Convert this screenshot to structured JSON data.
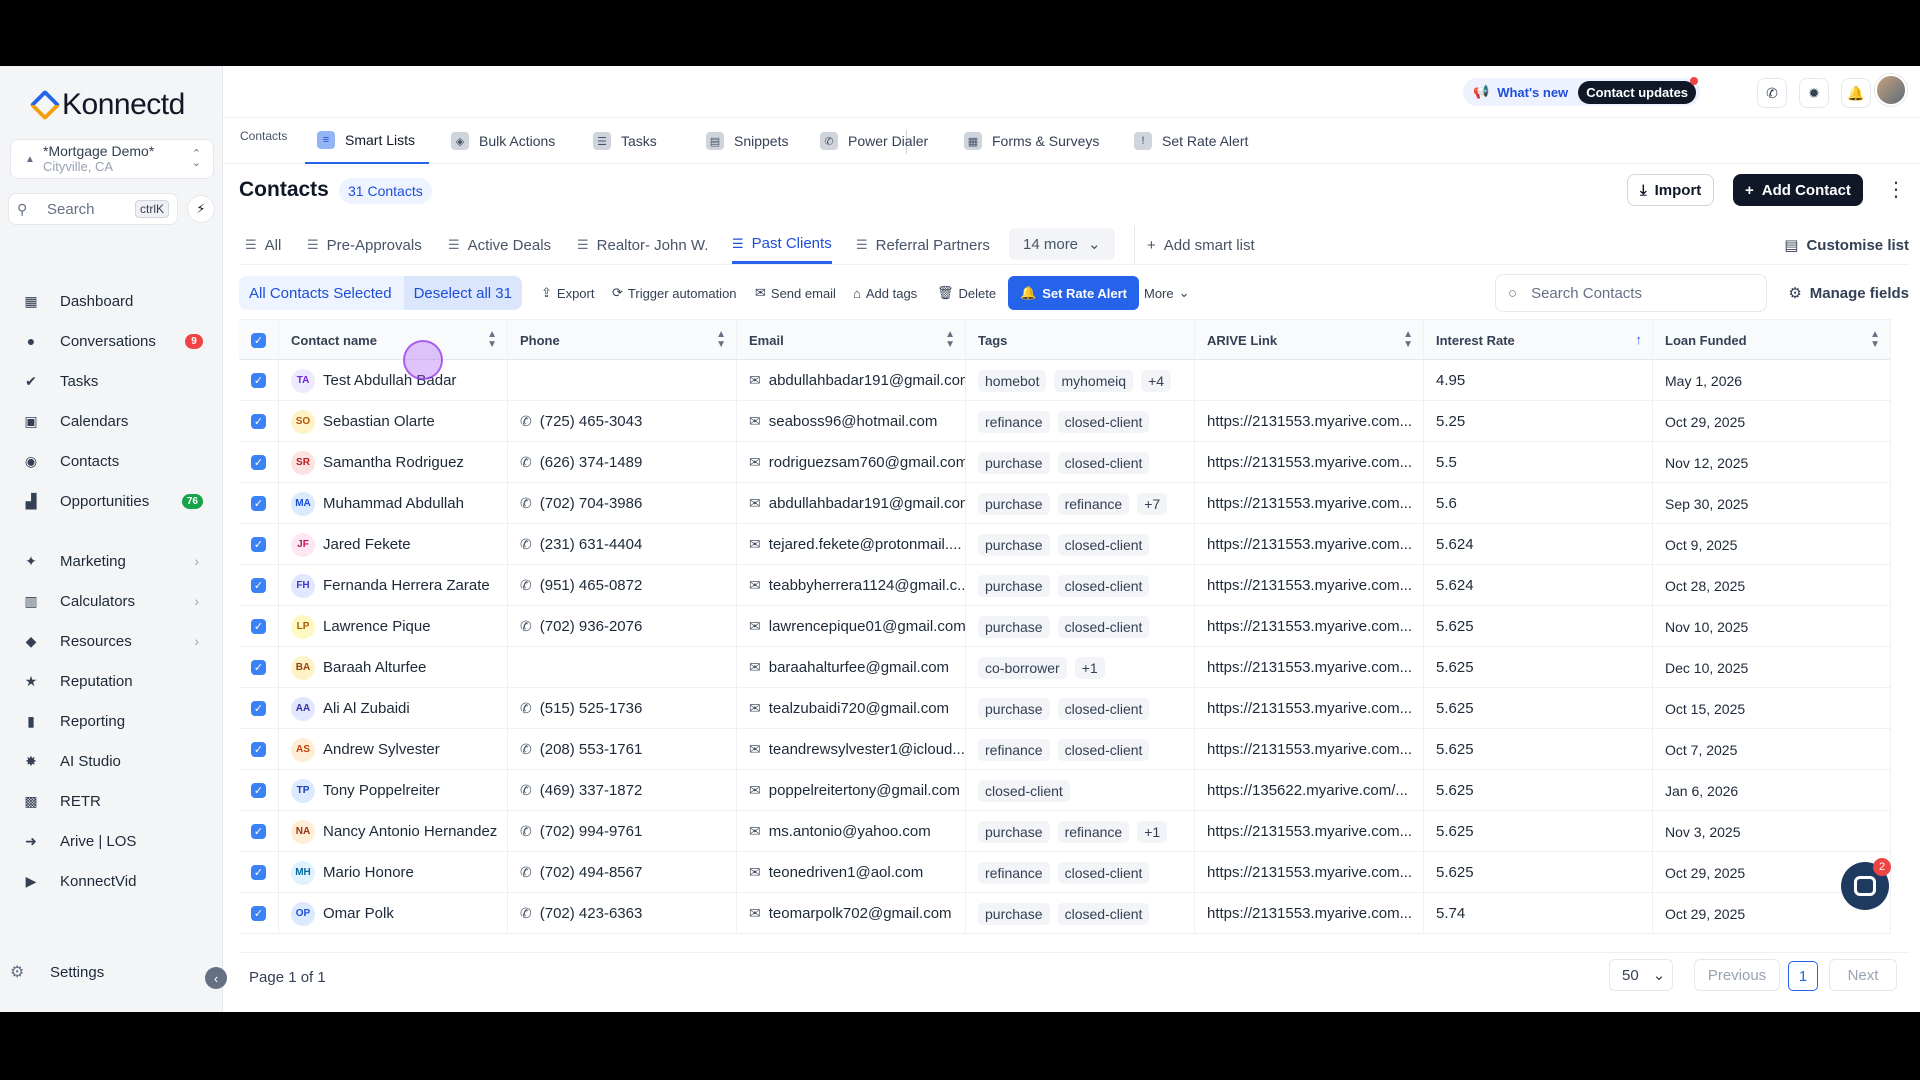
{
  "brand": {
    "name": "Konnectd"
  },
  "location": {
    "name": "*Mortgage Demo*",
    "sub": "Cityville, CA"
  },
  "sidebar_search": {
    "label": "Search",
    "shortcut": "ctrlK"
  },
  "nav": [
    {
      "label": "Dashboard",
      "icon": "dashboard-icon"
    },
    {
      "label": "Conversations",
      "icon": "chat-icon",
      "badge": "9",
      "badge_color": "#ef4444"
    },
    {
      "label": "Tasks",
      "icon": "check-circle-icon"
    },
    {
      "label": "Calendars",
      "icon": "calendar-icon"
    },
    {
      "label": "Contacts",
      "icon": "contact-icon"
    },
    {
      "label": "Opportunities",
      "icon": "funnel-icon",
      "badge": "76",
      "badge_color": "#16a34a"
    },
    {
      "label": "Marketing",
      "icon": "megaphone-icon",
      "arrow": true
    },
    {
      "label": "Calculators",
      "icon": "calculator-icon",
      "arrow": true
    },
    {
      "label": "Resources",
      "icon": "resources-icon",
      "arrow": true
    },
    {
      "label": "Reputation",
      "icon": "star-icon"
    },
    {
      "label": "Reporting",
      "icon": "chart-icon"
    },
    {
      "label": "AI Studio",
      "icon": "sparkle-icon"
    },
    {
      "label": "RETR",
      "icon": "retr-icon"
    },
    {
      "label": "Arive | LOS",
      "icon": "arive-icon"
    },
    {
      "label": "KonnectVid",
      "icon": "play-icon"
    }
  ],
  "settings_label": "Settings",
  "header": {
    "whats_new": "What's new",
    "contact_updates": "Contact updates"
  },
  "top_tabs": {
    "contacts_label": "Contacts",
    "items": [
      "Smart Lists",
      "Bulk Actions",
      "Tasks",
      "Snippets",
      "Power Dialer",
      "Forms & Surveys",
      "Set Rate Alert"
    ]
  },
  "page": {
    "title": "Contacts",
    "count": "31 Contacts",
    "import": "Import",
    "add_contact": "Add Contact"
  },
  "smart_lists": {
    "items": [
      "All",
      "Pre-Approvals",
      "Active Deals",
      "Realtor- John W.",
      "Past Clients",
      "Referral Partners"
    ],
    "more": "14 more",
    "add": "Add smart list",
    "customise": "Customise list"
  },
  "actions": {
    "all_selected": "All Contacts Selected",
    "deselect": "Deselect all 31",
    "export": "Export",
    "trigger": "Trigger automation",
    "send_email": "Send email",
    "add_tags": "Add tags",
    "delete": "Delete",
    "set_rate_alert": "Set Rate Alert",
    "more": "More",
    "search_placeholder": "Search Contacts",
    "manage_fields": "Manage fields"
  },
  "table": {
    "columns": [
      "Contact name",
      "Phone",
      "Email",
      "Tags",
      "ARIVE Link",
      "Interest Rate",
      "Loan Funded"
    ],
    "rows": [
      {
        "initials": "TA",
        "name": "Test Abdullah Badar",
        "phone": "",
        "email": "abdullahbadar191@gmail.com",
        "tags": [
          "homebot",
          "myhomeiq",
          "+4"
        ],
        "link": "",
        "rate": "4.95",
        "funded": "May 1, 2026"
      },
      {
        "initials": "SO",
        "name": "Sebastian Olarte",
        "phone": "(725) 465-3043",
        "email": "seaboss96@hotmail.com",
        "tags": [
          "refinance",
          "closed-client"
        ],
        "link": "https://2131553.myarive.com...",
        "rate": "5.25",
        "funded": "Oct 29, 2025"
      },
      {
        "initials": "SR",
        "name": "Samantha Rodriguez",
        "phone": "(626) 374-1489",
        "email": "rodriguezsam760@gmail.com",
        "tags": [
          "purchase",
          "closed-client"
        ],
        "link": "https://2131553.myarive.com...",
        "rate": "5.5",
        "funded": "Nov 12, 2025"
      },
      {
        "initials": "MA",
        "name": "Muhammad Abdullah",
        "phone": "(702) 704-3986",
        "email": "abdullahbadar191@gmail.com",
        "tags": [
          "purchase",
          "refinance",
          "+7"
        ],
        "link": "https://2131553.myarive.com...",
        "rate": "5.6",
        "funded": "Sep 30, 2025"
      },
      {
        "initials": "JF",
        "name": "Jared Fekete",
        "phone": "(231) 631-4404",
        "email": "tejared.fekete@protonmail....",
        "tags": [
          "purchase",
          "closed-client"
        ],
        "link": "https://2131553.myarive.com...",
        "rate": "5.624",
        "funded": "Oct 9, 2025"
      },
      {
        "initials": "FH",
        "name": "Fernanda Herrera Zarate",
        "phone": "(951) 465-0872",
        "email": "teabbyherrera1124@gmail.c...",
        "tags": [
          "purchase",
          "closed-client"
        ],
        "link": "https://2131553.myarive.com...",
        "rate": "5.624",
        "funded": "Oct 28, 2025"
      },
      {
        "initials": "LP",
        "name": "Lawrence Pique",
        "phone": "(702) 936-2076",
        "email": "lawrencepique01@gmail.com",
        "tags": [
          "purchase",
          "closed-client"
        ],
        "link": "https://2131553.myarive.com...",
        "rate": "5.625",
        "funded": "Nov 10, 2025"
      },
      {
        "initials": "BA",
        "name": "Baraah Alturfee",
        "phone": "",
        "email": "baraahalturfee@gmail.com",
        "tags": [
          "co-borrower",
          "+1"
        ],
        "link": "https://2131553.myarive.com...",
        "rate": "5.625",
        "funded": "Dec 10, 2025"
      },
      {
        "initials": "AA",
        "name": "Ali Al Zubaidi",
        "phone": "(515) 525-1736",
        "email": "tealzubaidi720@gmail.com",
        "tags": [
          "purchase",
          "closed-client"
        ],
        "link": "https://2131553.myarive.com...",
        "rate": "5.625",
        "funded": "Oct 15, 2025"
      },
      {
        "initials": "AS",
        "name": "Andrew Sylvester",
        "phone": "(208) 553-1761",
        "email": "teandrewsylvester1@icloud....",
        "tags": [
          "refinance",
          "closed-client"
        ],
        "link": "https://2131553.myarive.com...",
        "rate": "5.625",
        "funded": "Oct 7, 2025"
      },
      {
        "initials": "TP",
        "name": "Tony Poppelreiter",
        "phone": "(469) 337-1872",
        "email": "poppelreitertony@gmail.com",
        "tags": [
          "closed-client"
        ],
        "link": "https://135622.myarive.com/...",
        "rate": "5.625",
        "funded": "Jan 6, 2026"
      },
      {
        "initials": "NA",
        "name": "Nancy Antonio Hernandez",
        "phone": "(702) 994-9761",
        "email": "ms.antonio@yahoo.com",
        "tags": [
          "purchase",
          "refinance",
          "+1"
        ],
        "link": "https://2131553.myarive.com...",
        "rate": "5.625",
        "funded": "Nov 3, 2025"
      },
      {
        "initials": "MH",
        "name": "Mario Honore",
        "phone": "(702) 494-8567",
        "email": "teonedriven1@aol.com",
        "tags": [
          "refinance",
          "closed-client"
        ],
        "link": "https://2131553.myarive.com...",
        "rate": "5.625",
        "funded": "Oct 29, 2025"
      },
      {
        "initials": "OP",
        "name": "Omar Polk",
        "phone": "(702) 423-6363",
        "email": "teomarpolk702@gmail.com",
        "tags": [
          "purchase",
          "closed-client"
        ],
        "link": "https://2131553.myarive.com...",
        "rate": "5.74",
        "funded": "Oct 29, 2025"
      }
    ]
  },
  "footer": {
    "page": "Page 1 of 1",
    "per_page": "50",
    "previous": "Previous",
    "current": "1",
    "next": "Next"
  },
  "chat_badge": "2",
  "colors": {
    "accent": "#2563eb",
    "sidebar_bg": "#f4f5f7",
    "dark_button": "#101828"
  }
}
